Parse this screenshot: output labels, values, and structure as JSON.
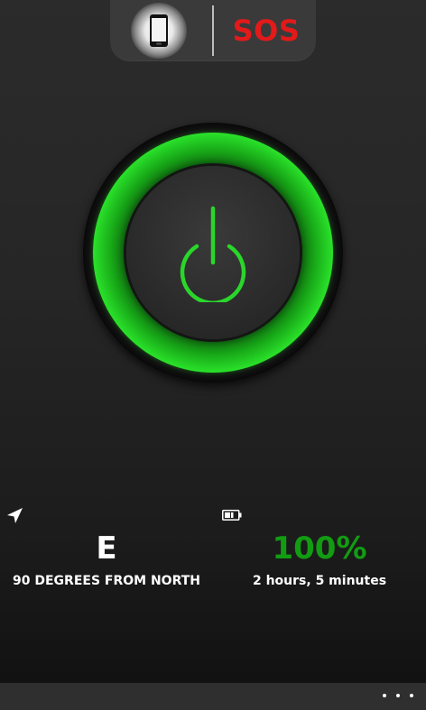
{
  "top_toggle": {
    "modes": [
      {
        "name": "phone",
        "icon": "smartphone-icon",
        "selected": true
      },
      {
        "name": "sos",
        "label": "SOS",
        "color": "#e21a1a",
        "selected": false
      }
    ]
  },
  "power_button": {
    "icon": "power-icon",
    "state": "on",
    "accent_color": "#2ad62a"
  },
  "compass": {
    "icon": "navigation-arrow-icon",
    "direction": "E",
    "description": "90 DEGREES FROM NORTH"
  },
  "battery": {
    "icon": "battery-icon",
    "percent_label": "100%",
    "percent_color": "#129c12",
    "remaining": "2 hours, 5 minutes"
  },
  "app_bar": {
    "more_icon": "more-options-icon"
  }
}
